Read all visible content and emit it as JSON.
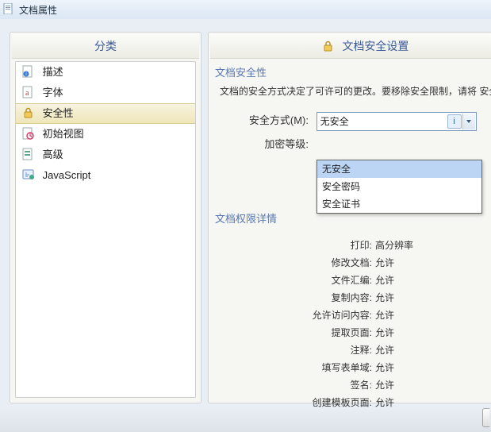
{
  "window": {
    "title": "文档属性"
  },
  "left_panel": {
    "header": "分类",
    "items": [
      {
        "label": "描述"
      },
      {
        "label": "字体"
      },
      {
        "label": "安全性"
      },
      {
        "label": "初始视图"
      },
      {
        "label": "高级"
      },
      {
        "label": "JavaScript"
      }
    ],
    "selected_index": 2
  },
  "right_panel": {
    "header": "文档安全设置",
    "section1_title": "文档安全性",
    "section1_desc": "文档的安全方式决定了可许可的更改。要移除安全限制，请将 安全",
    "security_method_label": "安全方式(M):",
    "security_method_value": "无安全",
    "encryption_level_label": "加密等级:",
    "dropdown_items": [
      "无安全",
      "安全密码",
      "安全证书"
    ],
    "dropdown_hl_index": 0,
    "section2_title": "文档权限详情",
    "permissions": [
      {
        "label": "打印:",
        "value": "高分辨率"
      },
      {
        "label": "修改文档:",
        "value": "允许"
      },
      {
        "label": "文件汇编:",
        "value": "允许"
      },
      {
        "label": "复制内容:",
        "value": "允许"
      },
      {
        "label": "允许访问内容:",
        "value": "允许"
      },
      {
        "label": "提取页面:",
        "value": "允许"
      },
      {
        "label": "注释:",
        "value": "允许"
      },
      {
        "label": "填写表单域:",
        "value": "允许"
      },
      {
        "label": "签名:",
        "value": "允许"
      },
      {
        "label": "创建模板页面:",
        "value": "允许"
      }
    ]
  }
}
